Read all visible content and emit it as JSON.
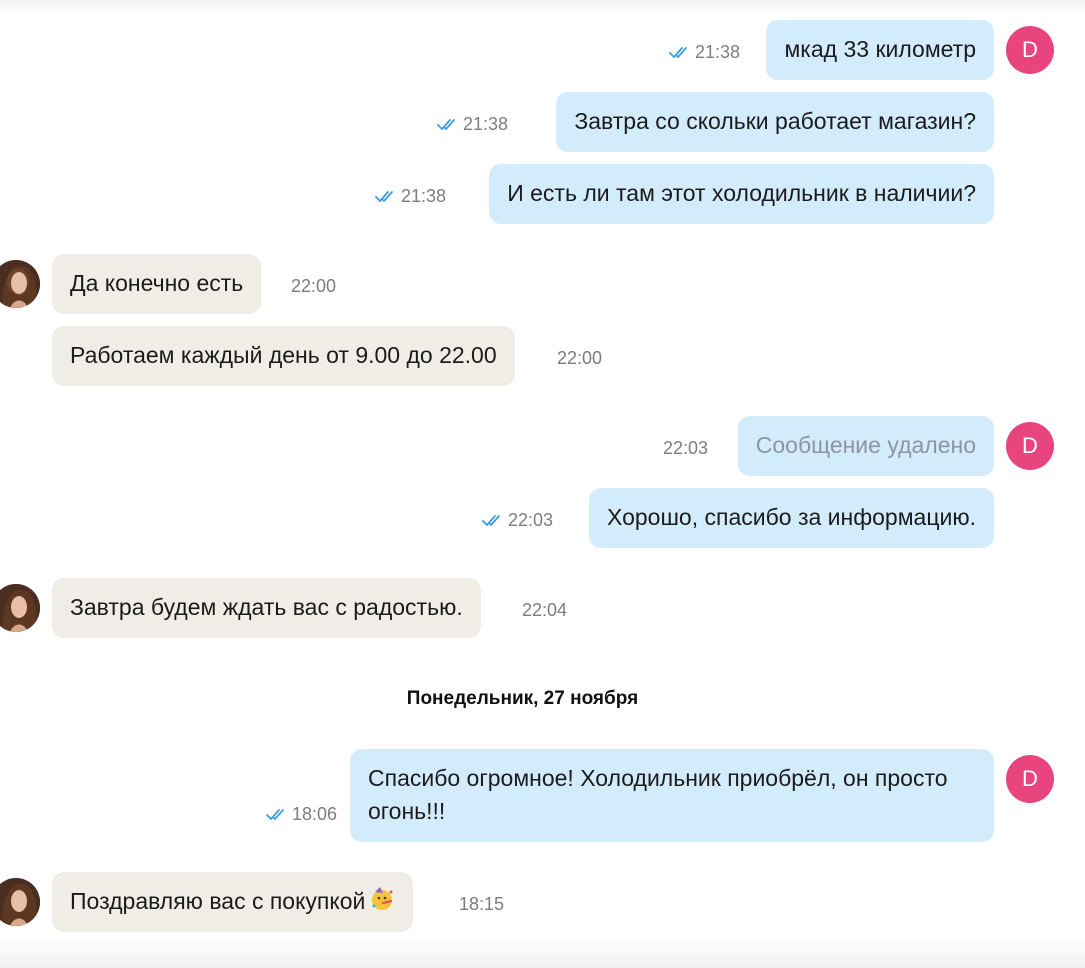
{
  "user_avatar_letter": "D",
  "colors": {
    "outgoing_bubble": "#d3ecfc",
    "incoming_bubble": "#f0ede6",
    "read_tick": "#3a9ee0",
    "avatar_accent": "#e8457f"
  },
  "messages": [
    {
      "direction": "out",
      "text": "мкад 33 километр",
      "time": "21:38",
      "read": true
    },
    {
      "direction": "out",
      "text": "Завтра со скольки работает магазин?",
      "time": "21:38",
      "read": true
    },
    {
      "direction": "out",
      "text": "И есть ли там этот холодильник в наличии?",
      "time": "21:38",
      "read": true
    },
    {
      "direction": "in",
      "text": "Да конечно есть",
      "time": "22:00"
    },
    {
      "direction": "in",
      "text": "Работаем каждый день от 9.00 до 22.00",
      "time": "22:00"
    },
    {
      "direction": "out",
      "text": "Сообщение удалено",
      "time": "22:03",
      "deleted": true
    },
    {
      "direction": "out",
      "text": "Хорошо, спасибо за информацию.",
      "time": "22:03",
      "read": true
    },
    {
      "direction": "in",
      "text": "Завтра будем ждать вас с радостью.",
      "time": "22:04"
    },
    {
      "direction": "out",
      "text": "Спасибо огромное! Холодильник приобрёл, он просто огонь!!!",
      "time": "18:06",
      "read": true
    },
    {
      "direction": "in",
      "text": "Поздравляю вас с покупкой",
      "time": "18:15",
      "emoji": "party-face-icon"
    }
  ],
  "date_separator": "Понедельник, 27 ноября"
}
